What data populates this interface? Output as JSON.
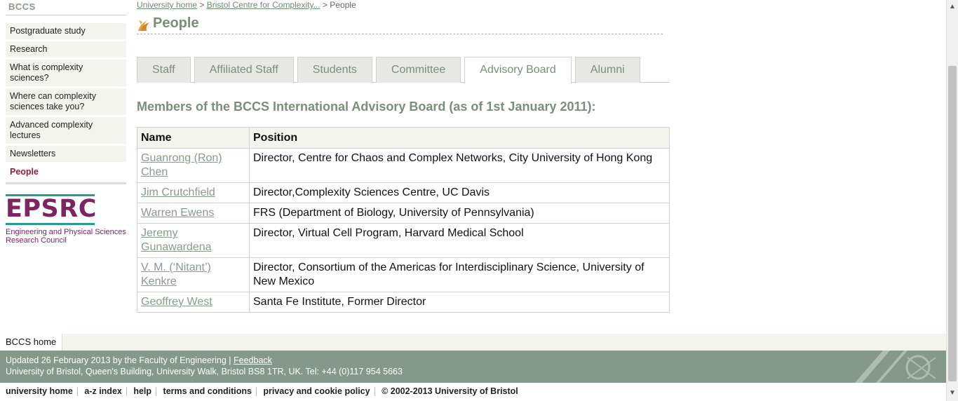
{
  "sidebar": {
    "title": "BCCS",
    "items": [
      {
        "label": "Postgraduate study"
      },
      {
        "label": "Research"
      },
      {
        "label": "What is complexity sciences?"
      },
      {
        "label": "Where can complexity sciences take you?"
      },
      {
        "label": "Advanced complexity lectures"
      },
      {
        "label": "Newsletters"
      },
      {
        "label": "People",
        "active": true
      }
    ],
    "logo": {
      "word": "EPSRC",
      "line1": "Engineering and Physical Sciences",
      "line2": "Research Council",
      "colors": {
        "text": "#7d2563",
        "bars": "#2a9b8e"
      }
    }
  },
  "breadcrumb": {
    "items": [
      "University home",
      "Bristol Centre for Complexity...",
      "People"
    ],
    "separator": ">"
  },
  "page": {
    "title": "People",
    "icon": "flame-icon"
  },
  "tabs": [
    {
      "label": "Staff"
    },
    {
      "label": "Affiliated Staff"
    },
    {
      "label": "Students"
    },
    {
      "label": "Committee"
    },
    {
      "label": "Advisory Board",
      "active": true
    },
    {
      "label": "Alumni"
    }
  ],
  "content": {
    "heading": "Members of the BCCS International Advisory Board (as of 1st January 2011):",
    "table": {
      "headers": [
        "Name",
        "Position"
      ],
      "rows": [
        {
          "name": "Guanrong (Ron) Chen",
          "position": "Director, Centre for Chaos and Complex Networks, City University of Hong Kong"
        },
        {
          "name": "Jim Crutchfield",
          "position": "Director,Complexity Sciences Centre, UC Davis"
        },
        {
          "name": "Warren Ewens",
          "position": "FRS (Department of Biology, University of Pennsylvania)"
        },
        {
          "name": "Jeremy Gunawardena",
          "position": "Director, Virtual Cell Program, Harvard Medical School"
        },
        {
          "name": "V. M. (‘Nitant’) Kenkre",
          "position": "Director, Consortium of the Americas for Interdisciplinary Science, University of New Mexico"
        },
        {
          "name": "Geoffrey West",
          "position": "Santa Fe Institute, Former Director"
        }
      ]
    }
  },
  "footer": {
    "home_label": "BCCS home",
    "updated": "Updated 26 February 2013 by the Faculty of Engineering",
    "separator": "|",
    "feedback": "Feedback",
    "address": "University of Bristol, Queen's Building, University Walk, Bristol BS8 1TR, UK. Tel: +44 (0)117 954 5663",
    "links": [
      "university home",
      "a-z index",
      "help",
      "terms and conditions",
      "privacy and cookie policy",
      "© 2002-2013 University of Bristol"
    ]
  },
  "colors": {
    "accent_green": "#7a8e7c",
    "active_nav": "#8a1f3a",
    "footer_band": "#84998a"
  }
}
